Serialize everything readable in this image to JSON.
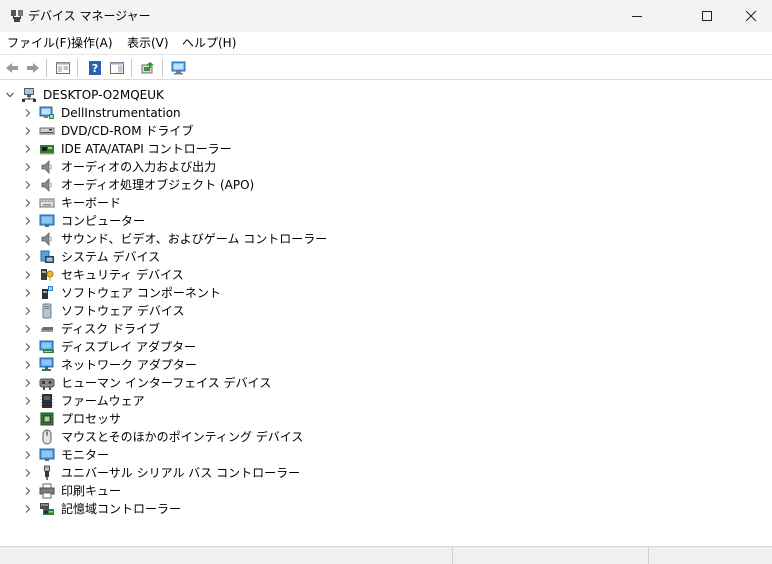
{
  "window": {
    "title": "デバイス マネージャー",
    "controls": [
      "minimize",
      "maximize",
      "close"
    ]
  },
  "menu": [
    {
      "label": "ファイル(F)"
    },
    {
      "label": "操作(A)"
    },
    {
      "label": "表示(V)"
    },
    {
      "label": "ヘルプ(H)"
    }
  ],
  "toolbar": {
    "buttons": [
      "back-icon",
      "forward-icon",
      "properties-window-icon",
      "help-icon",
      "action-pane-icon",
      "update-driver-icon",
      "scan-hardware-icon"
    ]
  },
  "tree": {
    "root": {
      "label": "DESKTOP-O2MQEUK",
      "expanded": true,
      "icon": "computer-network-icon"
    },
    "categories": [
      {
        "label": "DellInstrumentation",
        "icon": "monitor-chip-icon"
      },
      {
        "label": "DVD/CD-ROM ドライブ",
        "icon": "optical-drive-icon"
      },
      {
        "label": "IDE ATA/ATAPI コントローラー",
        "icon": "ide-controller-icon"
      },
      {
        "label": "オーディオの入力および出力",
        "icon": "speaker-icon"
      },
      {
        "label": "オーディオ処理オブジェクト (APO)",
        "icon": "speaker-icon"
      },
      {
        "label": "キーボード",
        "icon": "keyboard-icon"
      },
      {
        "label": "コンピューター",
        "icon": "monitor-icon"
      },
      {
        "label": "サウンド、ビデオ、およびゲーム コントローラー",
        "icon": "speaker-icon"
      },
      {
        "label": "システム デバイス",
        "icon": "system-device-icon"
      },
      {
        "label": "セキュリティ デバイス",
        "icon": "security-key-icon"
      },
      {
        "label": "ソフトウェア コンポーネント",
        "icon": "software-component-icon"
      },
      {
        "label": "ソフトウェア デバイス",
        "icon": "software-device-icon"
      },
      {
        "label": "ディスク ドライブ",
        "icon": "disk-drive-icon"
      },
      {
        "label": "ディスプレイ アダプター",
        "icon": "display-adapter-icon"
      },
      {
        "label": "ネットワーク アダプター",
        "icon": "network-adapter-icon"
      },
      {
        "label": "ヒューマン インターフェイス デバイス",
        "icon": "hid-icon"
      },
      {
        "label": "ファームウェア",
        "icon": "firmware-icon"
      },
      {
        "label": "プロセッサ",
        "icon": "processor-icon"
      },
      {
        "label": "マウスとそのほかのポインティング デバイス",
        "icon": "mouse-icon"
      },
      {
        "label": "モニター",
        "icon": "monitor-icon"
      },
      {
        "label": "ユニバーサル シリアル バス コントローラー",
        "icon": "usb-icon"
      },
      {
        "label": "印刷キュー",
        "icon": "printer-icon"
      },
      {
        "label": "記憶域コントローラー",
        "icon": "storage-controller-icon"
      }
    ]
  },
  "colors": {
    "titlebar_bg": "#f3f3f3",
    "status_bg": "#f0f0f0",
    "accent_blue": "#1f6fc9",
    "chevron": "#606060"
  }
}
